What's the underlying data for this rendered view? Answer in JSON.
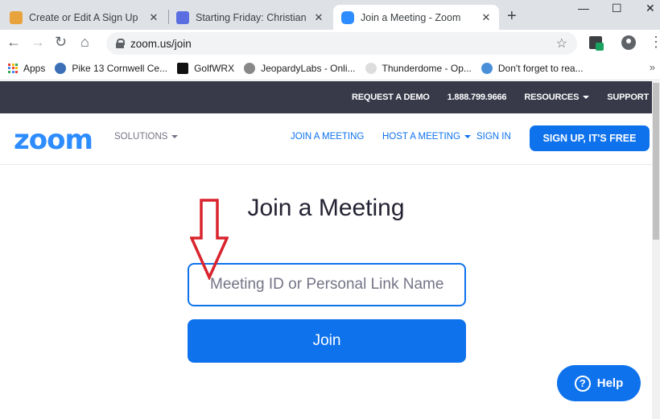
{
  "browser": {
    "tabs": [
      {
        "title": "Create or Edit A Sign Up",
        "close": "✕",
        "favicon_color": "#e8a33d"
      },
      {
        "title": "Starting Friday: Christian Fel",
        "close": "✕",
        "favicon_color": "#5b6ee1"
      },
      {
        "title": "Join a Meeting - Zoom",
        "close": "✕",
        "favicon_color": "#2d8cff"
      }
    ],
    "new_tab": "+",
    "url": "zoom.us/join",
    "bookmarks": [
      {
        "label": "Apps"
      },
      {
        "label": "Pike 13 Cornwell Ce...",
        "icon_color": "#3b6fb6"
      },
      {
        "label": "GolfWRX",
        "icon_color": "#111111"
      },
      {
        "label": "JeopardyLabs - Onli...",
        "icon_color": "#888888"
      },
      {
        "label": "Thunderdome - Op...",
        "icon_color": "#bbbbbb"
      },
      {
        "label": "Don't forget to rea...",
        "icon_color": "#4a90d9"
      }
    ],
    "bookmarks_more": "»"
  },
  "site": {
    "topbar": {
      "request_demo": "REQUEST A DEMO",
      "phone": "1.888.799.9666",
      "resources": "RESOURCES",
      "support": "SUPPORT"
    },
    "nav": {
      "logo": "zoom",
      "solutions": "SOLUTIONS",
      "join_meeting": "JOIN A MEETING",
      "host_meeting": "HOST A MEETING",
      "sign_in": "SIGN IN",
      "sign_up": "SIGN UP, IT'S FREE"
    },
    "main": {
      "title": "Join a Meeting",
      "input_placeholder": "Meeting ID or Personal Link Name",
      "join_label": "Join"
    },
    "help_label": "Help"
  },
  "colors": {
    "brand_blue": "#0e72ed",
    "topbar_bg": "#383a4a",
    "annotation_arrow": "#d9232d"
  }
}
